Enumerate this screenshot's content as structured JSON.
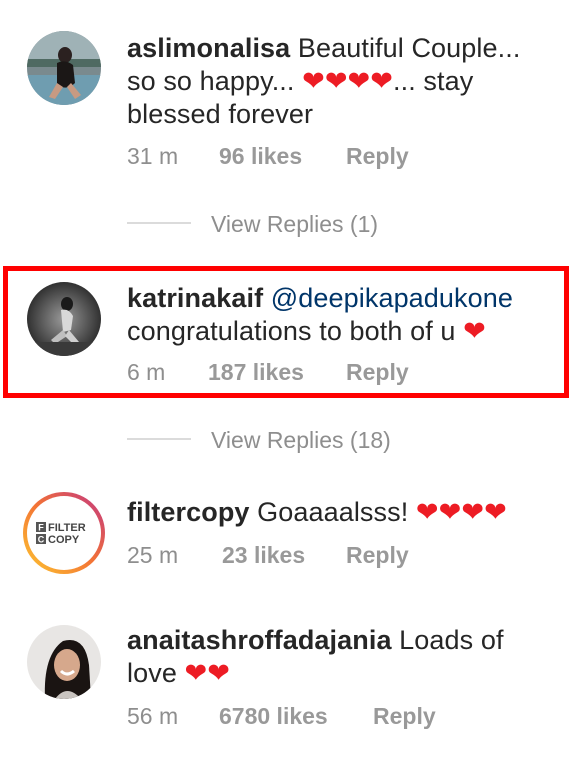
{
  "comments": [
    {
      "username": "aslimonalisa",
      "text_before": " Beautiful Couple... so so happy... ",
      "hearts": "❤❤❤❤",
      "text_after": "... stay blessed forever",
      "time": "31 m",
      "likes": "96 likes",
      "reply": "Reply",
      "view_replies": "View Replies (1)"
    },
    {
      "username": "katrinakaif",
      "mention": "@deepikapadukone",
      "text_before": "congratulations to both of u ",
      "hearts": "❤",
      "time": "6 m",
      "likes": "187 likes",
      "reply": "Reply",
      "view_replies": "View Replies (18)"
    },
    {
      "username": "filtercopy",
      "text_before": " Goaaaalsss! ",
      "hearts": "❤❤❤❤",
      "time": "25 m",
      "likes": "23 likes",
      "reply": "Reply",
      "avatar_logo_top": "FILTER",
      "avatar_logo_bottom": "COPY",
      "avatar_logo_f": "F",
      "avatar_logo_c": "C"
    },
    {
      "username": "anaitashroffadajania",
      "text_before": " Loads of love ",
      "hearts": "❤❤",
      "time": "56 m",
      "likes": "6780 likes",
      "reply": "Reply"
    }
  ],
  "colors": {
    "highlight_border": "#ff0000",
    "mention": "#003569",
    "heart": "#ed1c24",
    "meta": "#8e8e8e"
  }
}
